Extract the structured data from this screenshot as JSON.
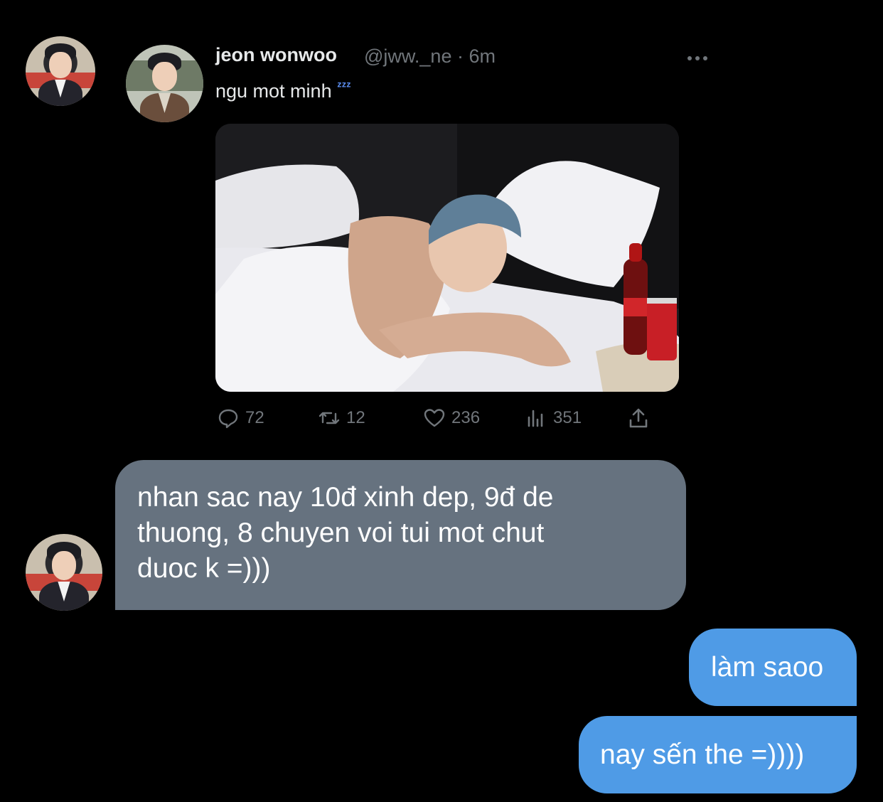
{
  "tweet": {
    "name": "jeon wonwoo",
    "handle_time": "@jww._ne · 6m",
    "text": "ngu mot minh",
    "emoji": "zzz-emoji",
    "media": "photo-person-in-bed",
    "stats": {
      "replies": "72",
      "retweets": "12",
      "likes": "236",
      "views": "351"
    }
  },
  "messages": {
    "incoming": [
      "nhan sac nay 10đ xinh dep, 9đ de",
      "thuong, 8 chuyen voi tui mot chut",
      "duoc k =)))"
    ],
    "outgoing_1": "làm saoo",
    "outgoing_2": "nay sến the =))))"
  },
  "colors": {
    "background": "#000000",
    "incoming_bubble": "#66727f",
    "outgoing_bubble": "#4f9be6",
    "muted_text": "#71767b"
  }
}
